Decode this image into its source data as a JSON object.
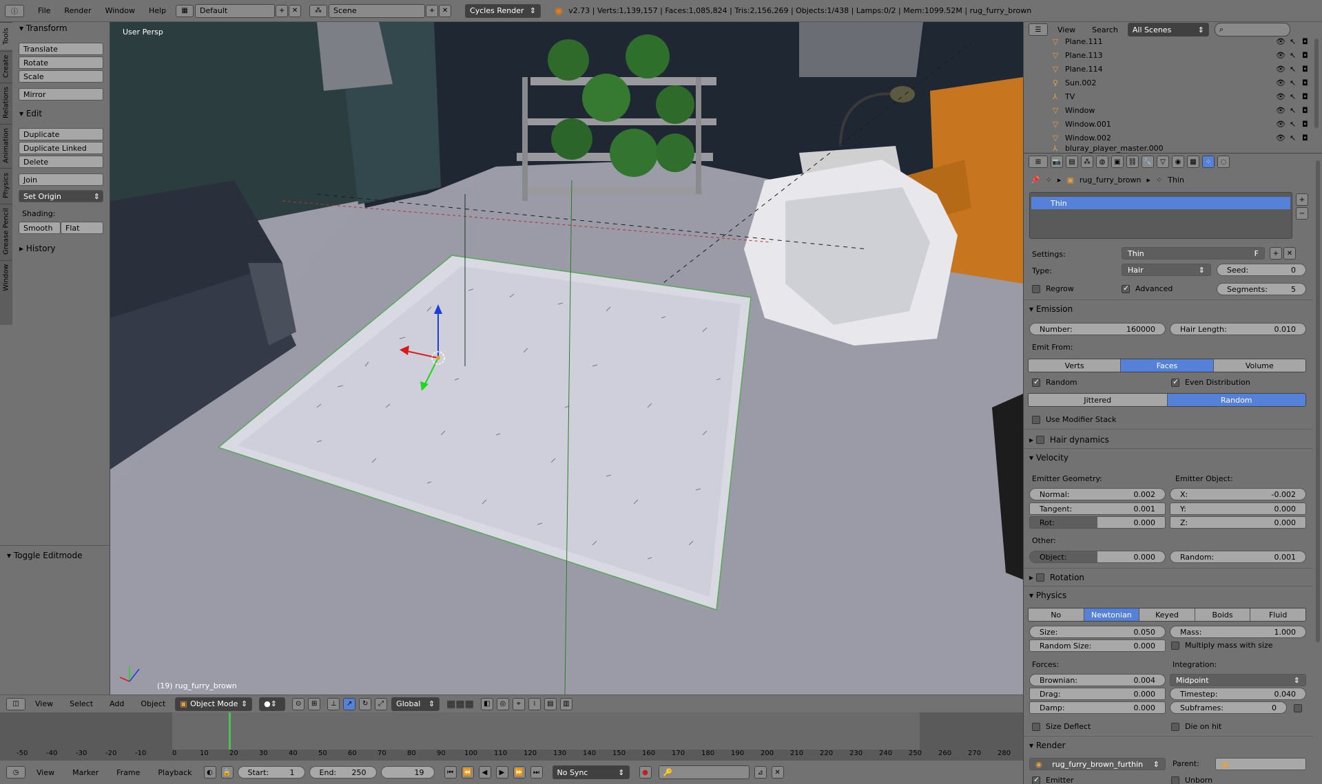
{
  "topbar": {
    "menus": [
      "File",
      "Render",
      "Window",
      "Help"
    ],
    "screen": "Default",
    "scene": "Scene",
    "renderer": "Cycles Render",
    "stats": "v2.73 | Verts:1,139,157 | Faces:1,085,824 | Tris:2,156,269 | Objects:1/438 | Lamps:0/2 | Mem:1099.52M | rug_furry_brown"
  },
  "vtabs": [
    "Tools",
    "Create",
    "Relations",
    "Animation",
    "Physics",
    "Grease Pencil",
    "Window"
  ],
  "tools": {
    "transform_hdr": "Transform",
    "translate": "Translate",
    "rotate": "Rotate",
    "scale": "Scale",
    "mirror": "Mirror",
    "edit_hdr": "Edit",
    "duplicate": "Duplicate",
    "duplicate_linked": "Duplicate Linked",
    "delete": "Delete",
    "join": "Join",
    "set_origin": "Set Origin",
    "shading_lbl": "Shading:",
    "smooth": "Smooth",
    "flat": "Flat",
    "history_hdr": "History",
    "toggle_editmode": "Toggle Editmode"
  },
  "viewport": {
    "label": "User Persp",
    "object_info": "(19) rug_furry_brown",
    "header": {
      "menus": [
        "View",
        "Select",
        "Add",
        "Object"
      ],
      "mode": "Object Mode",
      "orientation": "Global"
    }
  },
  "timeline": {
    "ticks": [
      "-50",
      "-40",
      "-30",
      "-20",
      "-10",
      "0",
      "10",
      "20",
      "30",
      "40",
      "50",
      "60",
      "70",
      "80",
      "90",
      "100",
      "110",
      "120",
      "130",
      "140",
      "150",
      "160",
      "170",
      "180",
      "190",
      "200",
      "210",
      "220",
      "230",
      "240",
      "250",
      "260",
      "270",
      "280"
    ],
    "current_frame": 19,
    "header": {
      "menus": [
        "View",
        "Marker",
        "Frame",
        "Playback"
      ],
      "start_label": "Start:",
      "start": "1",
      "end_label": "End:",
      "end": "250",
      "frame": "19",
      "sync": "No Sync"
    }
  },
  "outliner": {
    "menus": [
      "View",
      "Search"
    ],
    "scene_filter": "All Scenes",
    "rows": [
      "Plane.111",
      "Plane.113",
      "Plane.114",
      "Sun.002",
      "TV",
      "Window",
      "Window.001",
      "Window.002",
      "bluray_player_master.000"
    ]
  },
  "props": {
    "breadcrumb_obj": "rug_furry_brown",
    "breadcrumb_ps": "Thin",
    "list_item": "Thin",
    "settings_lbl": "Settings:",
    "settings_val": "Thin",
    "settings_f": "F",
    "type_lbl": "Type:",
    "type_val": "Hair",
    "seed_lbl": "Seed:",
    "seed_val": "0",
    "regrow": "Regrow",
    "advanced": "Advanced",
    "segments_lbl": "Segments:",
    "segments_val": "5",
    "emission_hdr": "Emission",
    "number_lbl": "Number:",
    "number_val": "160000",
    "hairlen_lbl": "Hair Length:",
    "hairlen_val": "0.010",
    "emitfrom_lbl": "Emit From:",
    "emit_opts": [
      "Verts",
      "Faces",
      "Volume"
    ],
    "random": "Random",
    "even_dist": "Even Distribution",
    "dist_opts": [
      "Jittered",
      "Random"
    ],
    "use_modifier": "Use Modifier Stack",
    "hair_dyn": "Hair dynamics",
    "velocity_hdr": "Velocity",
    "emitter_geom": "Emitter Geometry:",
    "emitter_obj": "Emitter Object:",
    "normal_lbl": "Normal:",
    "normal_val": "0.002",
    "tangent_lbl": "Tangent:",
    "tangent_val": "0.001",
    "rot_lbl": "Rot:",
    "rot_val": "0.000",
    "x_lbl": "X:",
    "x_val": "-0.002",
    "y_lbl": "Y:",
    "y_val": "0.000",
    "z_lbl": "Z:",
    "z_val": "0.000",
    "other_lbl": "Other:",
    "object_lbl": "Object:",
    "object_val": "0.000",
    "random_lbl": "Random:",
    "random_val": "0.001",
    "rotation_hdr": "Rotation",
    "physics_hdr": "Physics",
    "phys_opts": [
      "No",
      "Newtonian",
      "Keyed",
      "Boids",
      "Fluid"
    ],
    "size_lbl": "Size:",
    "size_val": "0.050",
    "mass_lbl": "Mass:",
    "mass_val": "1.000",
    "randsize_lbl": "Random Size:",
    "randsize_val": "0.000",
    "mult_mass": "Multiply mass with size",
    "forces_lbl": "Forces:",
    "integration_lbl": "Integration:",
    "brownian_lbl": "Brownian:",
    "brownian_val": "0.004",
    "integration_val": "Midpoint",
    "drag_lbl": "Drag:",
    "drag_val": "0.000",
    "timestep_lbl": "Timestep:",
    "timestep_val": "0.040",
    "damp_lbl": "Damp:",
    "damp_val": "0.000",
    "subframes_lbl": "Subframes:",
    "subframes_val": "0",
    "size_deflect": "Size Deflect",
    "die_on_hit": "Die on hit",
    "render_hdr": "Render",
    "render_mat": "rug_furry_brown_furthin",
    "parent_lbl": "Parent:",
    "emitter": "Emitter",
    "unborn": "Unborn"
  }
}
